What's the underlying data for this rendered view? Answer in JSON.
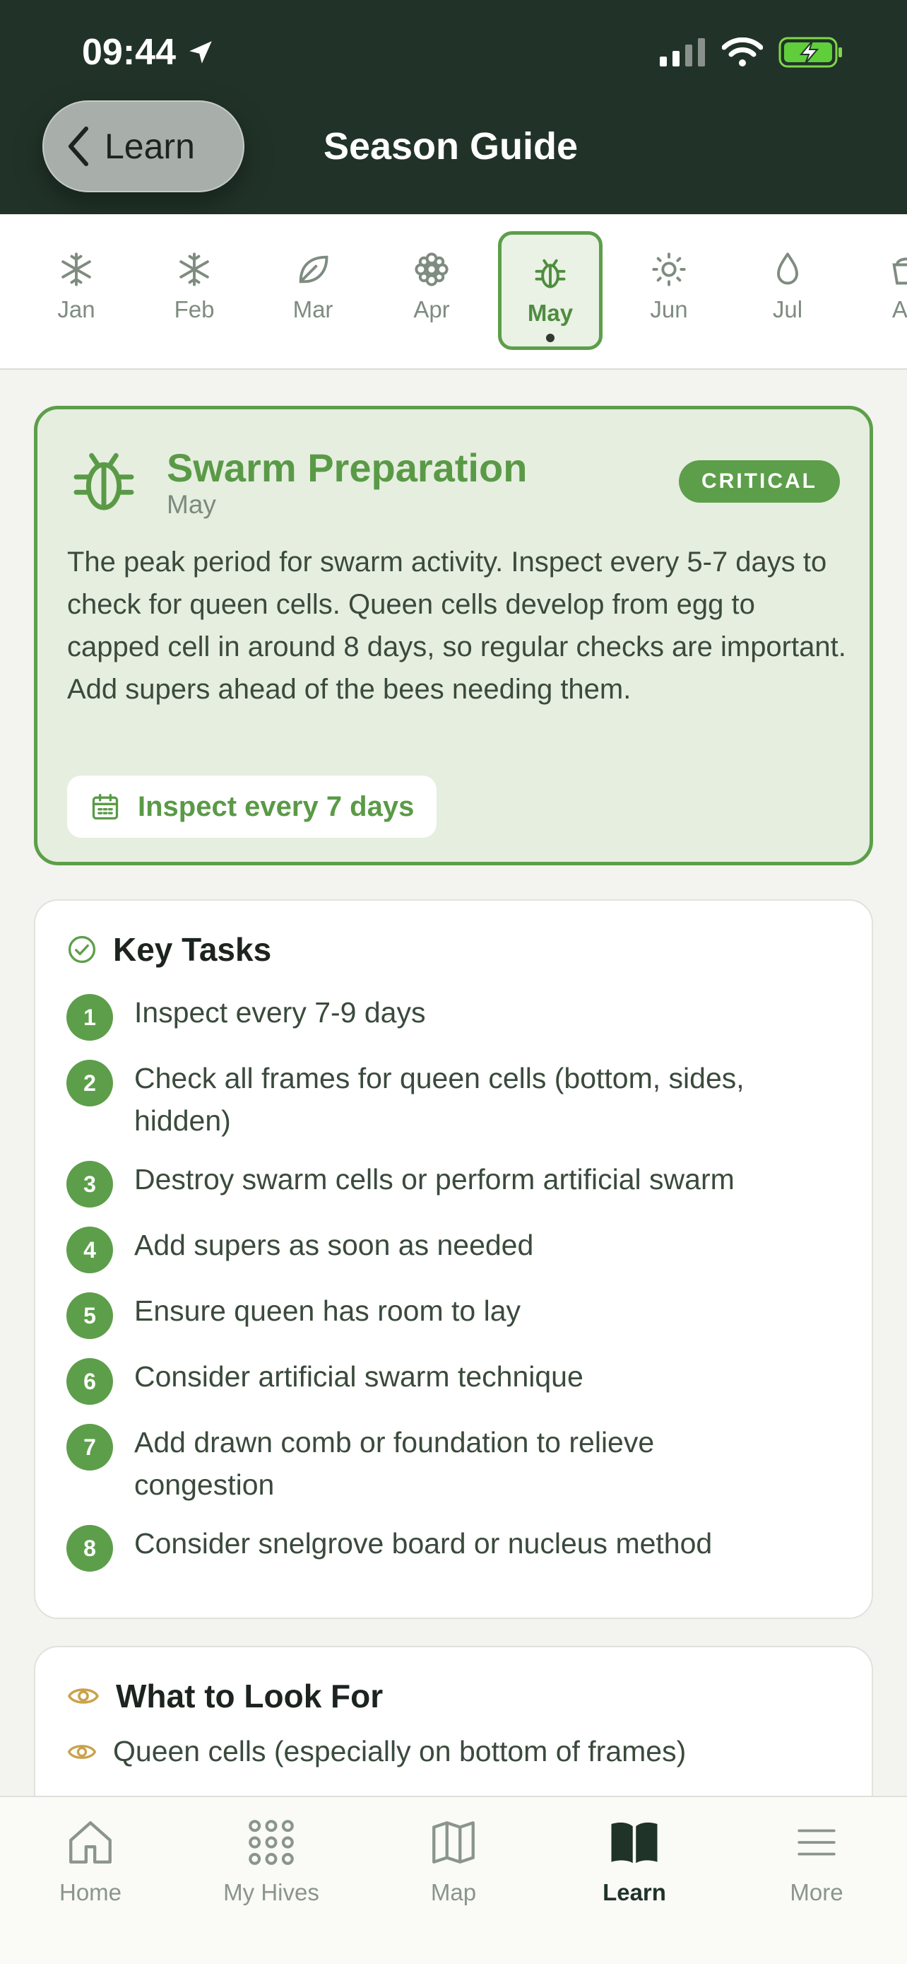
{
  "status_bar": {
    "time": "09:44"
  },
  "nav": {
    "back_label": "Learn",
    "title": "Season Guide"
  },
  "months": [
    {
      "label": "Jan",
      "icon": "snowflake-icon"
    },
    {
      "label": "Feb",
      "icon": "snowflake-icon"
    },
    {
      "label": "Mar",
      "icon": "leaf-icon"
    },
    {
      "label": "Apr",
      "icon": "flower-icon"
    },
    {
      "label": "May",
      "icon": "bug-icon",
      "selected": true
    },
    {
      "label": "Jun",
      "icon": "sun-icon"
    },
    {
      "label": "Jul",
      "icon": "droplet-icon"
    },
    {
      "label": "Au",
      "icon": "bucket-icon"
    }
  ],
  "hero": {
    "title": "Swarm Preparation",
    "month": "May",
    "badge": "CRITICAL",
    "description": "The peak period for swarm activity. Inspect every 5-7 days to check for queen cells. Queen cells develop from egg to capped cell in around 8 days, so regular checks are important. Add supers ahead of the bees needing them.",
    "frequency": "Inspect every 7 days"
  },
  "key_tasks": {
    "title": "Key Tasks",
    "items": [
      {
        "n": "1",
        "text": "Inspect every 7-9 days"
      },
      {
        "n": "2",
        "text": "Check all frames for queen cells (bottom, sides, hidden)"
      },
      {
        "n": "3",
        "text": "Destroy swarm cells or perform artificial swarm"
      },
      {
        "n": "4",
        "text": "Add supers as soon as needed"
      },
      {
        "n": "5",
        "text": "Ensure queen has room to lay"
      },
      {
        "n": "6",
        "text": "Consider artificial swarm technique"
      },
      {
        "n": "7",
        "text": "Add drawn comb or foundation to relieve congestion"
      },
      {
        "n": "8",
        "text": "Consider snelgrove board or nucleus method"
      }
    ]
  },
  "look_for": {
    "title": "What to Look For",
    "items": [
      "Queen cells (especially on bottom of frames)"
    ]
  },
  "tabs": [
    {
      "label": "Home",
      "icon": "home-icon"
    },
    {
      "label": "My Hives",
      "icon": "grid-dots-icon"
    },
    {
      "label": "Map",
      "icon": "map-icon"
    },
    {
      "label": "Learn",
      "icon": "book-icon",
      "active": true
    },
    {
      "label": "More",
      "icon": "menu-icon"
    }
  ],
  "colors": {
    "accent": "#5d9e4a",
    "header": "#213328",
    "look_icon": "#c9a24a"
  }
}
